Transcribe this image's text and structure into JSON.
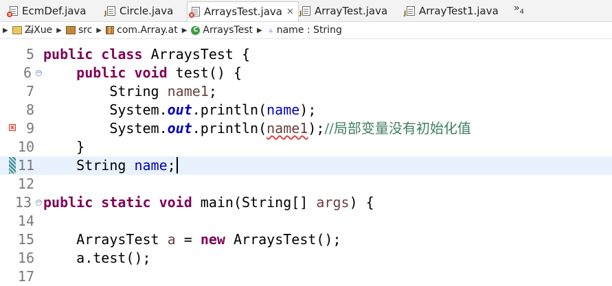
{
  "tabs": [
    {
      "label": "EcmDef.java",
      "active": false,
      "icon": "java-file-error-icon"
    },
    {
      "label": "Circle.java",
      "active": false,
      "icon": "java-file-icon"
    },
    {
      "label": "ArraysTest.java",
      "active": true,
      "icon": "java-file-error-icon",
      "close": "✕"
    },
    {
      "label": "ArrayTest.java",
      "active": false,
      "icon": "java-file-icon"
    },
    {
      "label": "ArrayTest1.java",
      "active": false,
      "icon": "java-file-icon"
    }
  ],
  "overflow": {
    "symbol": "»",
    "count": "4"
  },
  "breadcrumb": {
    "project": "ZiXue",
    "src": "src",
    "package": "com.Array.at",
    "class": "ArraysTest",
    "member": "name : String"
  },
  "editor": {
    "partial_line": "4",
    "lines": [
      {
        "num": "5"
      },
      {
        "num": "6"
      },
      {
        "num": "7"
      },
      {
        "num": "8"
      },
      {
        "num": "9"
      },
      {
        "num": "10"
      },
      {
        "num": "11"
      },
      {
        "num": "12"
      },
      {
        "num": "13"
      },
      {
        "num": "14"
      },
      {
        "num": "15"
      },
      {
        "num": "16"
      },
      {
        "num": "17"
      }
    ],
    "tokens": {
      "public": "public",
      "class": "class",
      "void": "void",
      "static": "static",
      "new": "new",
      "class_name": "ArraysTest",
      "open_brace": " {",
      "test_sig": " test() {",
      "string_type": "String",
      "name1": "name1",
      "semicolon": ";",
      "system": "System.",
      "out": "out",
      "println_open": ".println(",
      "name": "name",
      "close_paren_semi": ");",
      "comment": "//局部变量没有初始化值",
      "close_brace": "}",
      "main_sig": " main(String[] ",
      "args": "args",
      "main_end": ") {",
      "var_a": "a",
      "assign": " = ",
      "ctor_call": "ArraysTest();",
      "a_test": "a.test();"
    }
  },
  "colors": {
    "keyword": "#7f0055",
    "field": "#0000c0",
    "local_var": "#6a3e3e",
    "comment": "#3f7f5f",
    "current_line": "#e8f2fe"
  }
}
